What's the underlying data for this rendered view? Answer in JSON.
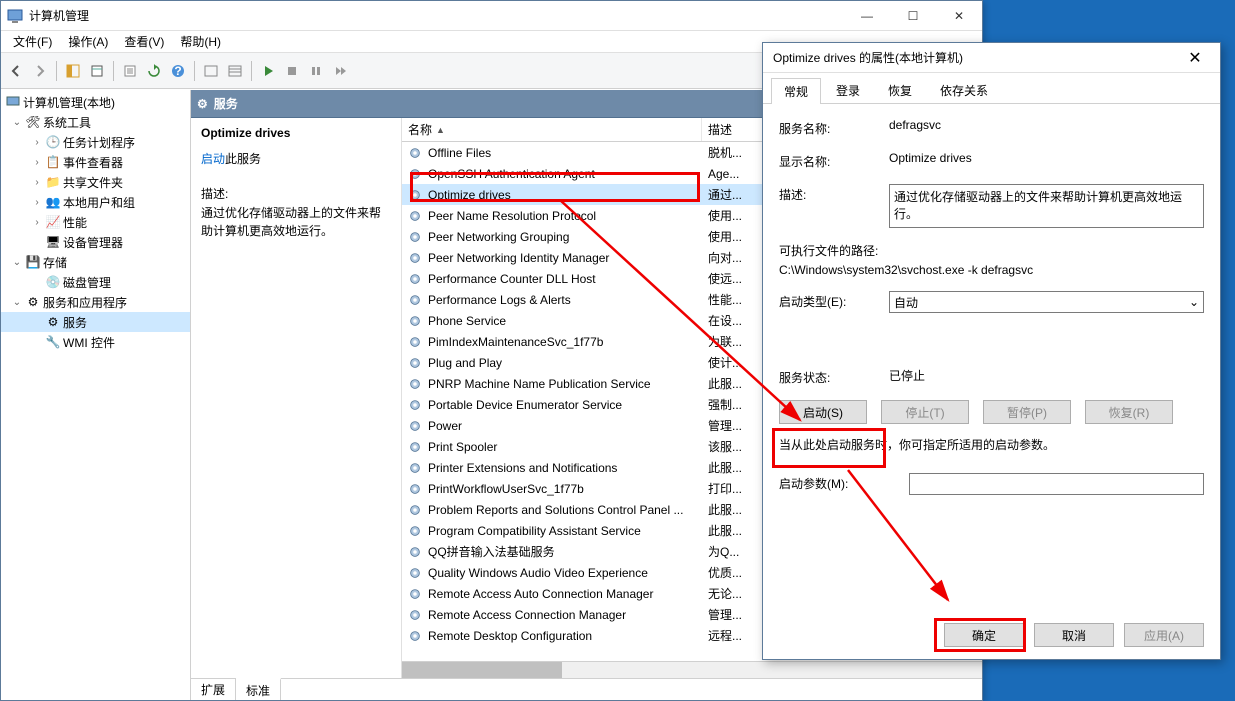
{
  "window": {
    "title": "计算机管理",
    "sys_buttons": {
      "min": "—",
      "max": "☐",
      "close": "✕"
    }
  },
  "menus": [
    "文件(F)",
    "操作(A)",
    "查看(V)",
    "帮助(H)"
  ],
  "tree": {
    "root": "计算机管理(本地)",
    "sys_tools": "系统工具",
    "task_sched": "任务计划程序",
    "event_viewer": "事件查看器",
    "shared": "共享文件夹",
    "local_users": "本地用户和组",
    "perf": "性能",
    "dev_mgr": "设备管理器",
    "storage": "存储",
    "disk_mgmt": "磁盘管理",
    "services_apps": "服务和应用程序",
    "services": "服务",
    "wmi": "WMI 控件"
  },
  "right": {
    "header": "服务",
    "selected_title": "Optimize drives",
    "start_link_prefix": "启动",
    "start_link_suffix": "此服务",
    "desc_label": "描述:",
    "desc": "通过优化存储驱动器上的文件来帮助计算机更高效地运行。",
    "cols": {
      "name": "名称",
      "desc": "描述"
    },
    "tabs": {
      "ext": "扩展",
      "std": "标准"
    }
  },
  "services": [
    {
      "name": "Offline Files",
      "desc": "脱机..."
    },
    {
      "name": "OpenSSH Authentication Agent",
      "desc": "Age..."
    },
    {
      "name": "Optimize drives",
      "desc": "通过..."
    },
    {
      "name": "Peer Name Resolution Protocol",
      "desc": "使用..."
    },
    {
      "name": "Peer Networking Grouping",
      "desc": "使用..."
    },
    {
      "name": "Peer Networking Identity Manager",
      "desc": "向对..."
    },
    {
      "name": "Performance Counter DLL Host",
      "desc": "使远..."
    },
    {
      "name": "Performance Logs & Alerts",
      "desc": "性能..."
    },
    {
      "name": "Phone Service",
      "desc": "在设..."
    },
    {
      "name": "PimIndexMaintenanceSvc_1f77b",
      "desc": "为联..."
    },
    {
      "name": "Plug and Play",
      "desc": "使计..."
    },
    {
      "name": "PNRP Machine Name Publication Service",
      "desc": "此服..."
    },
    {
      "name": "Portable Device Enumerator Service",
      "desc": "强制..."
    },
    {
      "name": "Power",
      "desc": "管理..."
    },
    {
      "name": "Print Spooler",
      "desc": "该服..."
    },
    {
      "name": "Printer Extensions and Notifications",
      "desc": "此服..."
    },
    {
      "name": "PrintWorkflowUserSvc_1f77b",
      "desc": "打印..."
    },
    {
      "name": "Problem Reports and Solutions Control Panel ...",
      "desc": "此服..."
    },
    {
      "name": "Program Compatibility Assistant Service",
      "desc": "此服..."
    },
    {
      "name": "QQ拼音输入法基础服务",
      "desc": "为Q..."
    },
    {
      "name": "Quality Windows Audio Video Experience",
      "desc": "优质..."
    },
    {
      "name": "Remote Access Auto Connection Manager",
      "desc": "无论..."
    },
    {
      "name": "Remote Access Connection Manager",
      "desc": "管理..."
    },
    {
      "name": "Remote Desktop Configuration",
      "desc": "远程..."
    }
  ],
  "dialog": {
    "title": "Optimize drives 的属性(本地计算机)",
    "tabs": [
      "常规",
      "登录",
      "恢复",
      "依存关系"
    ],
    "svc_name_label": "服务名称:",
    "svc_name": "defragsvc",
    "disp_name_label": "显示名称:",
    "disp_name": "Optimize drives",
    "desc_label": "描述:",
    "desc": "通过优化存储驱动器上的文件来帮助计算机更高效地运行。",
    "exe_label": "可执行文件的路径:",
    "exe": "C:\\Windows\\system32\\svchost.exe -k defragsvc",
    "startup_label": "启动类型(E):",
    "startup": "自动",
    "status_label": "服务状态:",
    "status": "已停止",
    "btn_start": "启动(S)",
    "btn_stop": "停止(T)",
    "btn_pause": "暂停(P)",
    "btn_resume": "恢复(R)",
    "hint": "当从此处启动服务时，你可指定所适用的启动参数。",
    "param_label": "启动参数(M):",
    "ok": "确定",
    "cancel": "取消",
    "apply": "应用(A)"
  }
}
